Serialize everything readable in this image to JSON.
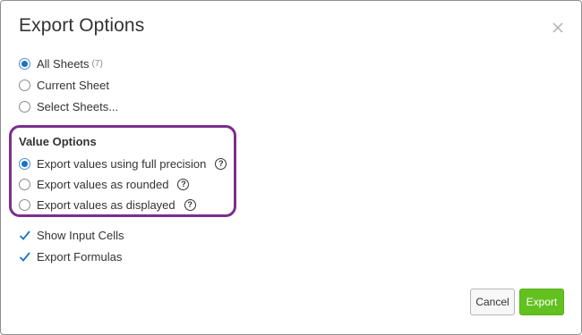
{
  "dialog": {
    "title": "Export Options",
    "close_icon": "close-icon"
  },
  "sheets": {
    "options": [
      {
        "label": "All Sheets",
        "count": "(7)",
        "selected": true
      },
      {
        "label": "Current Sheet",
        "selected": false
      },
      {
        "label": "Select Sheets...",
        "selected": false
      }
    ]
  },
  "value_options": {
    "title": "Value Options",
    "options": [
      {
        "label": "Export values using full precision",
        "selected": true,
        "help_icon": "help-icon"
      },
      {
        "label": "Export values as rounded",
        "selected": false,
        "help_icon": "help-icon"
      },
      {
        "label": "Export values as displayed",
        "selected": false,
        "help_icon": "help-icon"
      }
    ],
    "help_glyph": "?"
  },
  "checkboxes": [
    {
      "label": "Show Input Cells",
      "checked": true
    },
    {
      "label": "Export Formulas",
      "checked": true
    }
  ],
  "buttons": {
    "cancel_label": "Cancel",
    "export_label": "Export"
  },
  "colors": {
    "accent": "#1a73c6",
    "export_button": "#62c11f",
    "highlight": "#7b2e8e"
  }
}
